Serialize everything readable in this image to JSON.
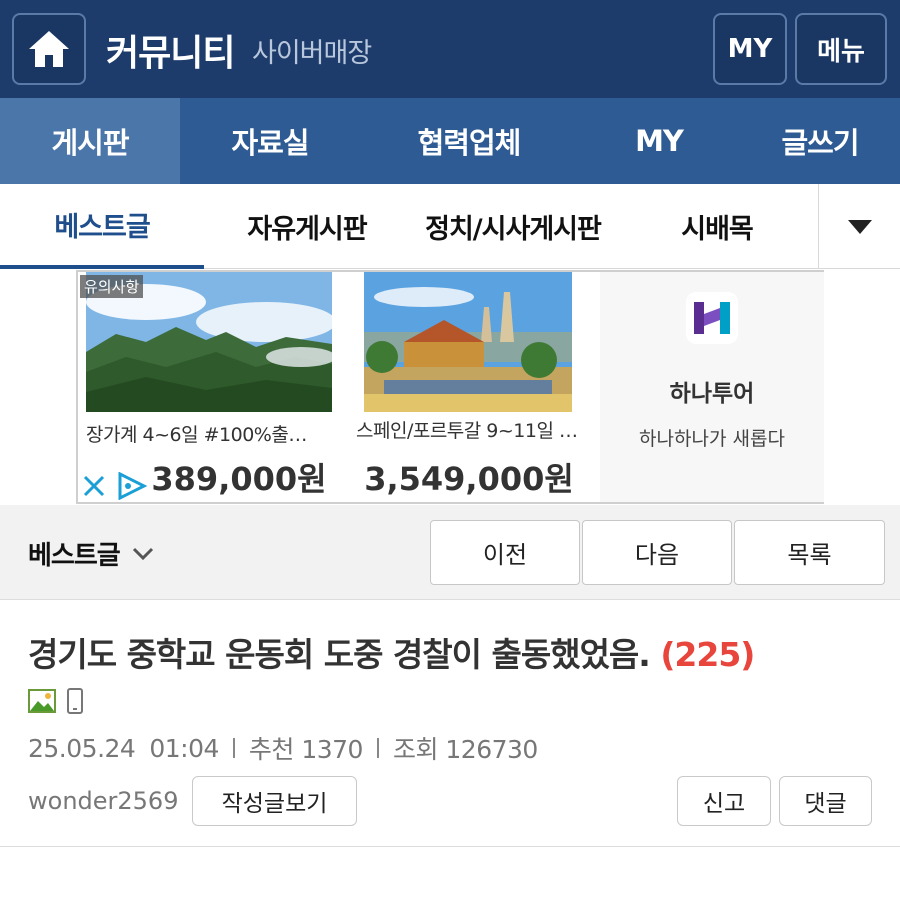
{
  "header": {
    "brand": "커뮤니티",
    "brand_sub": "사이버매장",
    "my_label": "MY",
    "menu_label": "메뉴",
    "bg_color": "#1d3c6b"
  },
  "main_nav": {
    "tabs": [
      {
        "label": "게시판",
        "active": true
      },
      {
        "label": "자료실",
        "active": false
      },
      {
        "label": "협력업체",
        "active": false
      },
      {
        "label": "MY",
        "active": false
      },
      {
        "label": "글쓰기",
        "active": false
      }
    ]
  },
  "sub_nav": {
    "tabs": [
      {
        "label": "베스트글",
        "active": true
      },
      {
        "label": "자유게시판",
        "active": false
      },
      {
        "label": "정치/시사게시판",
        "active": false
      },
      {
        "label": "시배목",
        "active": false
      }
    ],
    "more_icon": "caret-down-icon"
  },
  "ad": {
    "notice": "유의사항",
    "cards": [
      {
        "title": "장가계 4~6일 #100%출…",
        "price": "389,000원"
      },
      {
        "title": "스페인/포르투갈 9~11일 …",
        "price": "3,549,000원"
      }
    ],
    "brand_name": "하나투어",
    "brand_slogan": "하나하나가 새롭다"
  },
  "post_nav": {
    "category": "베스트글",
    "prev_label": "이전",
    "next_label": "다음",
    "list_label": "목록"
  },
  "post": {
    "title": "경기도 중학교 운동회 도중 경찰이 출동했었음.",
    "comment_count": "(225)",
    "date": "25.05.24",
    "time": "01:04",
    "recommend": "추천 1370",
    "views": "조회 126730",
    "author": "wonder2569",
    "author_posts_label": "작성글보기",
    "report_label": "신고",
    "comment_label": "댓글"
  }
}
